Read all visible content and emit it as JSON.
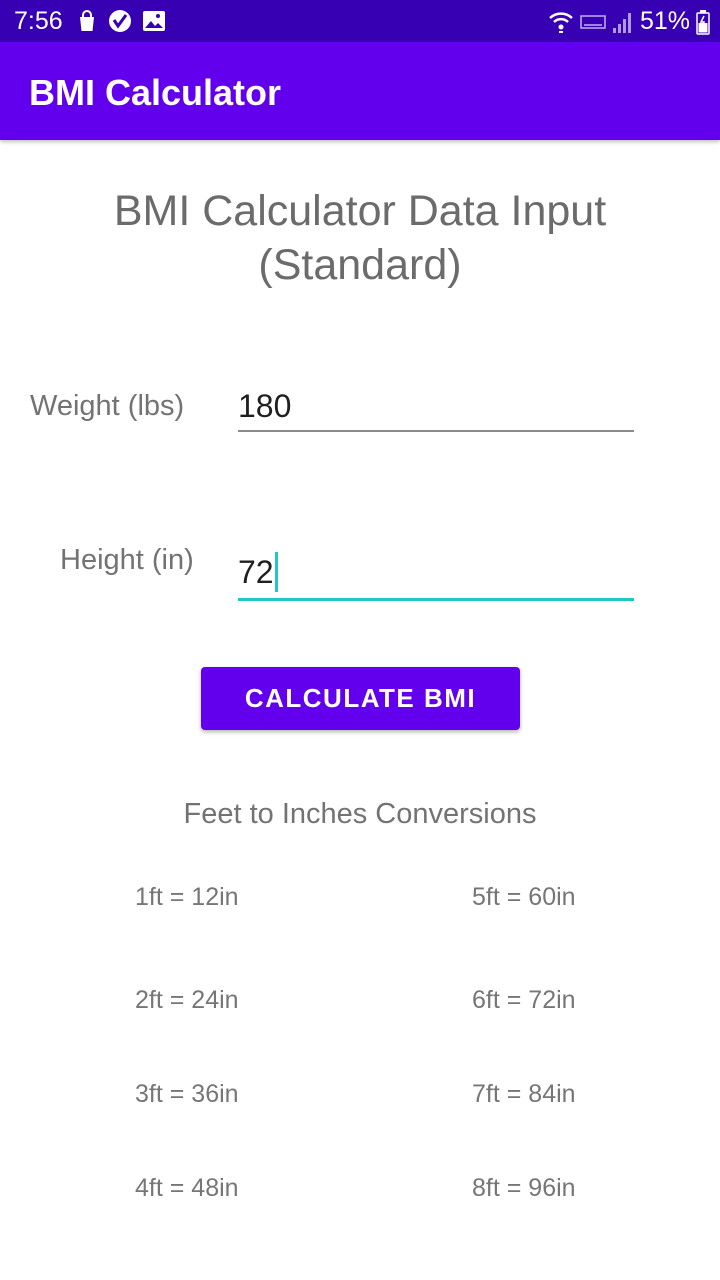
{
  "status_bar": {
    "time": "7:56",
    "battery": "51%",
    "icons_left": [
      "shopping-bag-icon",
      "verified-check-icon",
      "image-icon"
    ],
    "icons_right": [
      "wifi-icon",
      "volte-icon",
      "signal-icon",
      "battery-icon"
    ]
  },
  "app_bar": {
    "title": "BMI Calculator"
  },
  "form": {
    "heading_line1": "BMI Calculator Data Input",
    "heading_line2": "(Standard)",
    "weight_label": "Weight (lbs)",
    "weight_value": "180",
    "height_label": "Height (in)",
    "height_value": "72",
    "calculate_label": "CALCULATE BMI"
  },
  "conversions": {
    "title": "Feet to Inches Conversions",
    "left": [
      "1ft = 12in",
      "2ft = 24in",
      "3ft = 36in",
      "4ft = 48in"
    ],
    "right": [
      "5ft = 60in",
      "6ft = 72in",
      "7ft = 84in",
      "8ft = 96in"
    ]
  },
  "colors": {
    "status_bar": "#3700b3",
    "primary": "#6200ee",
    "focus_accent": "#1fc8c3",
    "label_text": "#737373"
  }
}
